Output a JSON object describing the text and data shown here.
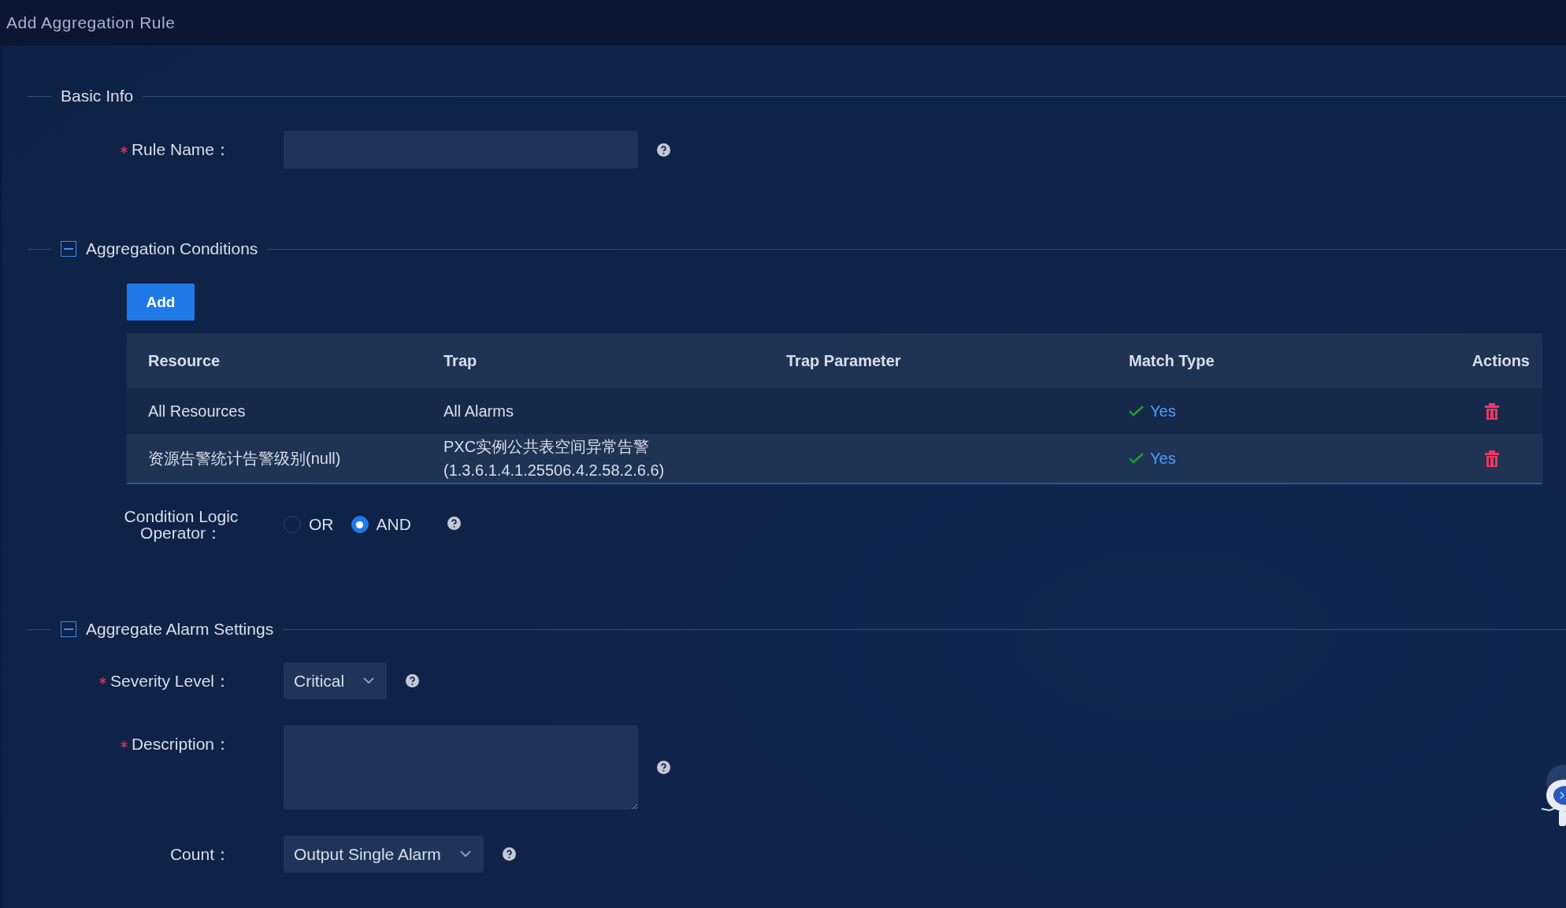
{
  "title": "Add Aggregation Rule",
  "basic_info": {
    "title": "Basic Info",
    "rule_name": {
      "label": "Rule Name：",
      "required": true
    }
  },
  "aggregation_conditions": {
    "title": "Aggregation Conditions",
    "expanded": true,
    "add_button": "Add",
    "table": {
      "columns": [
        "Resource",
        "Trap",
        "Trap Parameter",
        "Match Type",
        "Actions"
      ],
      "rows": [
        {
          "resource": "All Resources",
          "trap": [
            "All Alarms"
          ],
          "match_type": "Yes"
        },
        {
          "resource": "资源告警统计告警级别(null)",
          "trap": [
            "PXC实例公共表空间异常告警",
            "(1.3.6.1.4.1.25506.4.2.58.2.6.6)"
          ],
          "match_type": "Yes"
        }
      ]
    },
    "logic": {
      "label": "Condition Logic Operator：",
      "options": [
        {
          "label": "OR",
          "selected": false
        },
        {
          "label": "AND",
          "selected": true
        }
      ]
    }
  },
  "alarm_settings": {
    "title": "Aggregate Alarm Settings",
    "expanded": true,
    "fields": [
      {
        "kind": "select",
        "label": "Severity Level：",
        "required": true,
        "value": "Critical"
      },
      {
        "kind": "textarea",
        "label": "Description：",
        "required": true
      },
      {
        "kind": "select",
        "label": "Count：",
        "required": false,
        "value": "Output Single Alarm"
      }
    ]
  }
}
